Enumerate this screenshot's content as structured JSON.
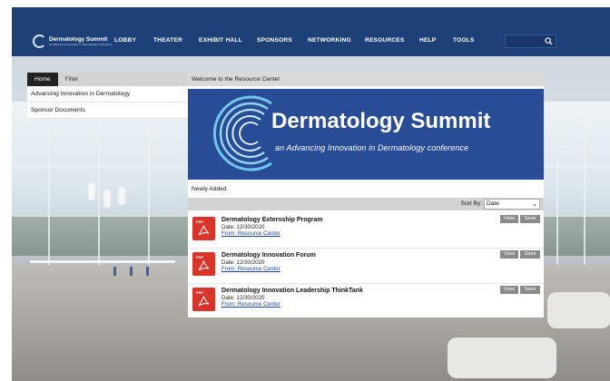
{
  "nav": {
    "logo": {
      "title": "Dermatology Summit",
      "tagline": "an Advancing Innovation in Dermatology conference"
    },
    "items": [
      "LOBBY",
      "THEATER",
      "EXHIBIT HALL",
      "SPONSORS",
      "NETWORKING",
      "RESOURCES",
      "HELP",
      "TOOLS"
    ],
    "search": {
      "icon": "search-icon"
    }
  },
  "left_panel": {
    "tabs": [
      "Home",
      "Filter"
    ],
    "items": [
      "Advancing Innovation in Dermatology",
      "Sponsor Documents"
    ]
  },
  "main_panel": {
    "header": "Welcome to the Resource Center",
    "banner": {
      "title": "Dermatology Summit",
      "subtitle": "an Advancing Innovation in Dermatology conference"
    },
    "section_label": "Newly Added",
    "sort": {
      "label": "Sort By:",
      "selected": "Date"
    },
    "documents": [
      {
        "icon": "pdf-icon",
        "icon_label": "PDF",
        "title": "Dermatology Externship Program",
        "date": "Date: 12/30/2020",
        "from": "From: Resource Center",
        "view_label": "View",
        "save_label": "Save"
      },
      {
        "icon": "pdf-icon",
        "icon_label": "PDF",
        "title": "Dermatology Innovation Forum",
        "date": "Date: 12/30/2020",
        "from": "From: Resource Center",
        "view_label": "View",
        "save_label": "Save"
      },
      {
        "icon": "pdf-icon",
        "icon_label": "PDF",
        "title": "Dermatology Innovation Leadership ThinkTank",
        "date": "Date: 12/30/2020",
        "from": "From: Resource Center",
        "view_label": "View",
        "save_label": "Save"
      }
    ]
  },
  "colors": {
    "nav_bg": "#1e4078",
    "banner_bg": "#294c97",
    "pdf_red": "#d9342b",
    "link": "#1a43a0"
  }
}
